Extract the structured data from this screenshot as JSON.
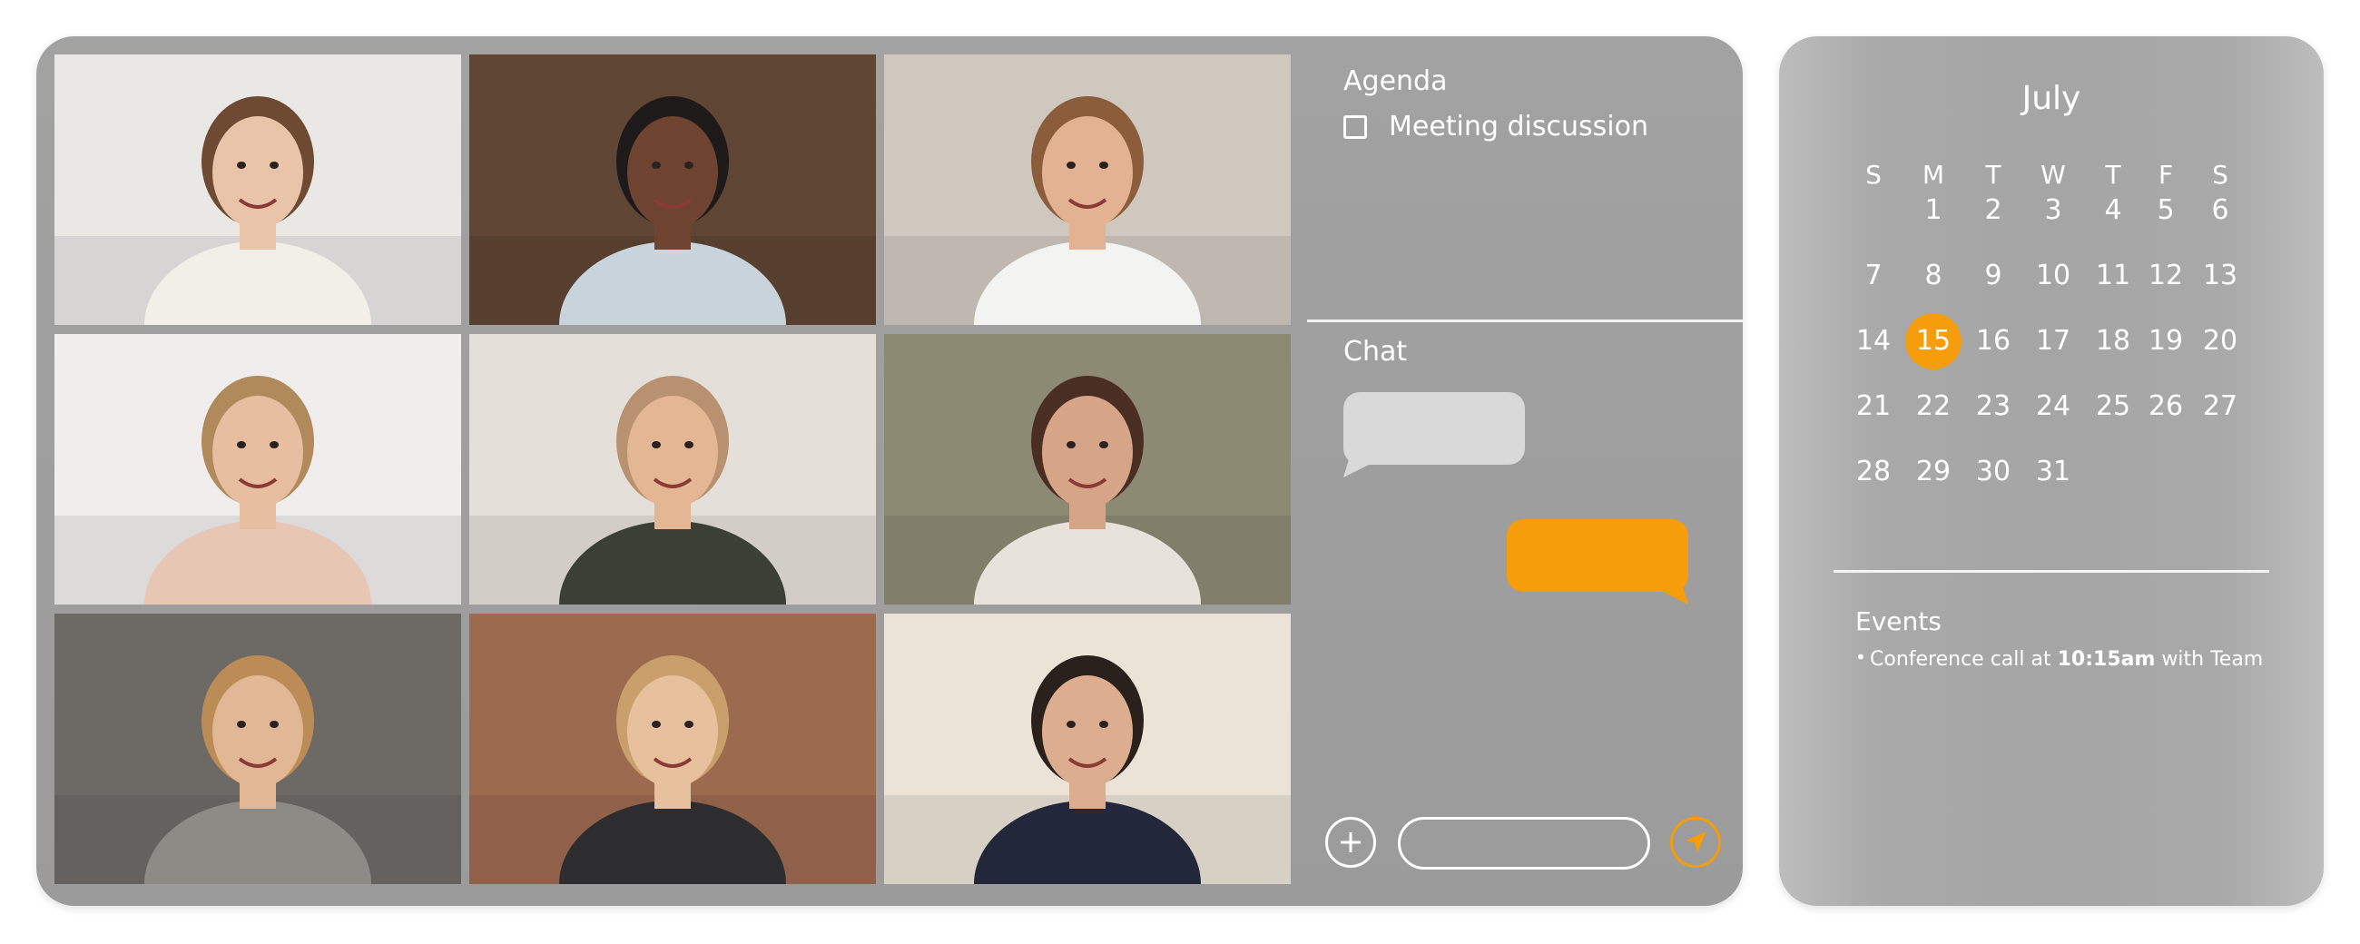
{
  "participants": [
    {
      "id": "p1",
      "bg": "#e9e8e5",
      "skin": "#e9c4a8",
      "hair": "#6e4a33",
      "shirt": "#f2efe9"
    },
    {
      "id": "p2",
      "bg": "#5e4534",
      "skin": "#6e4330",
      "hair": "#1d1a19",
      "shirt": "#c9d3dc"
    },
    {
      "id": "p3",
      "bg": "#cfc8bf",
      "skin": "#e2b293",
      "hair": "#8b5d3b",
      "shirt": "#f3f3f1"
    },
    {
      "id": "p4",
      "bg": "#efeeec",
      "skin": "#e7bea0",
      "hair": "#b08a5a",
      "shirt": "#e8c6b4"
    },
    {
      "id": "p5",
      "bg": "#e4dfd8",
      "skin": "#e3b694",
      "hair": "#b89270",
      "shirt": "#3b3f35"
    },
    {
      "id": "p6",
      "bg": "#8d8a74",
      "skin": "#d6a487",
      "hair": "#4a2e22",
      "shirt": "#e7e2da"
    },
    {
      "id": "p7",
      "bg": "#6d6a66",
      "skin": "#e2b796",
      "hair": "#bc8c57",
      "shirt": "#8c8b86"
    },
    {
      "id": "p8",
      "bg": "#9c6a4f",
      "skin": "#e7c19e",
      "hair": "#c9a06c",
      "shirt": "#2d2c2f"
    },
    {
      "id": "p9",
      "bg": "#eae3d6",
      "skin": "#dcae8f",
      "hair": "#2a211c",
      "shirt": "#23273a"
    }
  ],
  "agenda": {
    "title": "Agenda",
    "items": [
      {
        "label": "Meeting discussion",
        "checked": false
      }
    ]
  },
  "chat": {
    "title": "Chat",
    "input_value": "",
    "input_placeholder": ""
  },
  "colors": {
    "accent": "#f59d0a",
    "incoming_bubble": "#d9d9d9",
    "panel": "#a0a0a0"
  },
  "icons": {
    "add": "plus-circle-icon",
    "send": "send-arrow-icon"
  },
  "calendar": {
    "month": "July",
    "weekdays": [
      "S",
      "M",
      "T",
      "W",
      "T",
      "F",
      "S"
    ],
    "weeks": [
      [
        "",
        "1",
        "2",
        "3",
        "4",
        "5",
        "6"
      ],
      [
        "7",
        "8",
        "9",
        "10",
        "11",
        "12",
        "13"
      ],
      [
        "14",
        "15",
        "16",
        "17",
        "18",
        "19",
        "20"
      ],
      [
        "21",
        "22",
        "23",
        "24",
        "25",
        "26",
        "27"
      ],
      [
        "28",
        "29",
        "30",
        "31",
        "",
        "",
        ""
      ]
    ],
    "selected_day": "15"
  },
  "events": {
    "title": "Events",
    "items": [
      {
        "prefix": "Conference call at ",
        "time": "10:15am",
        "suffix": " with Team"
      }
    ]
  }
}
